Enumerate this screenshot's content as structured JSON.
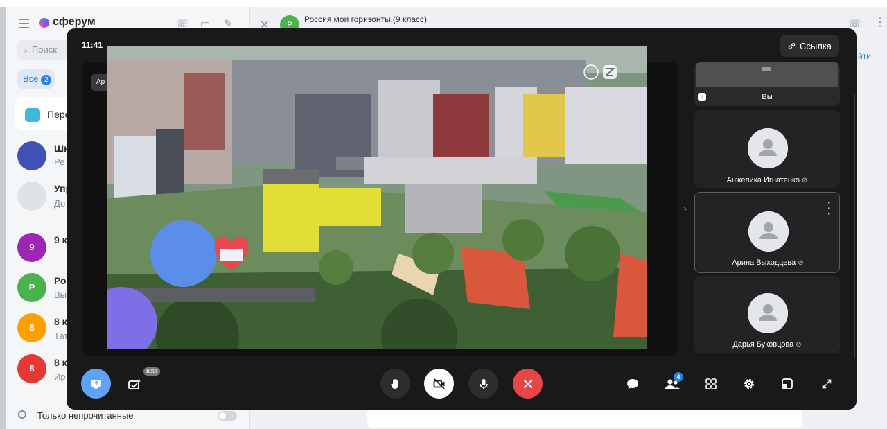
{
  "app": {
    "logo_text": "сферум",
    "search_placeholder": "Поиск",
    "filter_all_label": "Все",
    "filter_all_count": "2",
    "pinned_label": "Пере",
    "unread_only_label": "Только непрочитанные"
  },
  "chats": [
    {
      "avatar_text": "",
      "name": "Шк",
      "preview": "Ре",
      "color": "#3f51b5"
    },
    {
      "avatar_text": "",
      "name": "Упр",
      "preview": "До",
      "color": "#dfe3e8"
    },
    {
      "avatar_text": "9",
      "name": "9 к",
      "preview": "",
      "color": "#9c27b0"
    },
    {
      "avatar_text": "Р",
      "name": "Рос",
      "preview": "Вы",
      "color": "#4bb34b"
    },
    {
      "avatar_text": "8",
      "name": "8 к",
      "preview": "Тат",
      "color": "#ffa000"
    },
    {
      "avatar_text": "8",
      "name": "8 к",
      "preview": "Ир",
      "color": "#e53935"
    }
  ],
  "chat_header": {
    "avatar_text": "Р",
    "title": "Россия мои горизонты (9 класс)",
    "join_link": "йти"
  },
  "call": {
    "time": "11:41",
    "link_button": "Ссылка",
    "stage_tag": "Ар",
    "beta_label": "beta",
    "participants_count": "4",
    "self_label": "Вы",
    "participants": [
      {
        "name": "Анжелика Игнатенко",
        "muted": true,
        "active": false
      },
      {
        "name": "Арина Выходцева",
        "muted": true,
        "active": true
      },
      {
        "name": "Дарья Буковцова",
        "muted": true,
        "active": false
      }
    ]
  },
  "colors": {
    "accent": "#2d81e0",
    "end_call": "#e64646",
    "call_bg": "#19191a",
    "share_button": "#5ea3f7"
  },
  "icons": {
    "share": "screen-share-icon",
    "effects": "effects-icon",
    "hand": "raise-hand-icon",
    "camera": "camera-off-icon",
    "mic": "microphone-icon",
    "end": "end-call-icon",
    "chat": "chat-icon",
    "participants": "participants-icon",
    "grid": "grid-layout-icon",
    "settings": "settings-icon",
    "pip": "picture-in-picture-icon",
    "fullscreen": "fullscreen-icon"
  }
}
